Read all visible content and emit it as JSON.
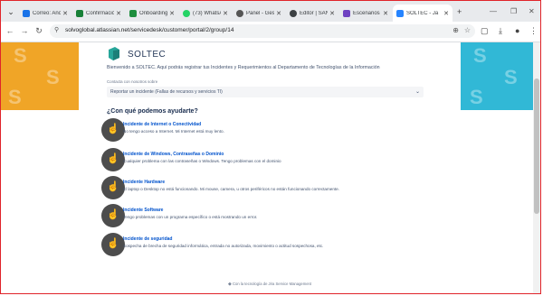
{
  "browser": {
    "tabs": [
      {
        "label": "Correo: Ancl",
        "color": "#1a73e8"
      },
      {
        "label": "Confirmació",
        "color": "#188038"
      },
      {
        "label": "OnboardingI",
        "color": "#1e8e3e"
      },
      {
        "label": "(73) WhatsA",
        "color": "#25d366"
      },
      {
        "label": "Panel - Gest",
        "color": "#555555"
      },
      {
        "label": "Editor | SAN",
        "color": "#3c4043"
      },
      {
        "label": "Escenarios –",
        "color": "#6f42c1"
      },
      {
        "label": "SOLTEC - Ja",
        "color": "#2684ff",
        "active": true
      }
    ],
    "new_tab": "+",
    "url": "solvoglobal.atlassian.net/servicedesk/customer/portal/2/group/14"
  },
  "portal": {
    "brand": "SOLTEC",
    "welcome": "Bienvenido a SOLTEC. Aquí podrás registrar tus Incidentes y Requerimientos al Departamento de Tecnologías de la Información",
    "contact_label": "Contacta con nosotros sobre",
    "select_value": "Reportar un incidente (Fallas de recursos y servicios TI)",
    "help_heading": "¿Con qué podemos ayudarte?",
    "options": [
      {
        "title": "Incidente de Internet o Conectividad",
        "desc": "No tengo acceso a Internet. Mi Internet está muy lento."
      },
      {
        "title": "Incidente de Windows, Contraseñas o Dominio",
        "desc": "Cualquier problema con las contraseñas o Windows. Tengo problemas con el dominio"
      },
      {
        "title": "Incidente Hardware",
        "desc": "El laptop o Desktop no está funcionando. Mi mouse, camera, u otros periféricos no están funcionando correctamente."
      },
      {
        "title": "Incidente Software",
        "desc": "Tengo problemas con un programa específico o está mostrando un error."
      },
      {
        "title": "Incidente de seguridad",
        "desc": "Sospecha de brecha de seguridad informática, entrada no autorizada, movimiento o actitud sospechosa, etc."
      }
    ],
    "footer": "Con la tecnología de  Jira Service Management"
  },
  "colors": {
    "band_left": "#f0a527",
    "band_right": "#31b8d6",
    "accent": "#0052cc",
    "frame": "#e0242a"
  }
}
